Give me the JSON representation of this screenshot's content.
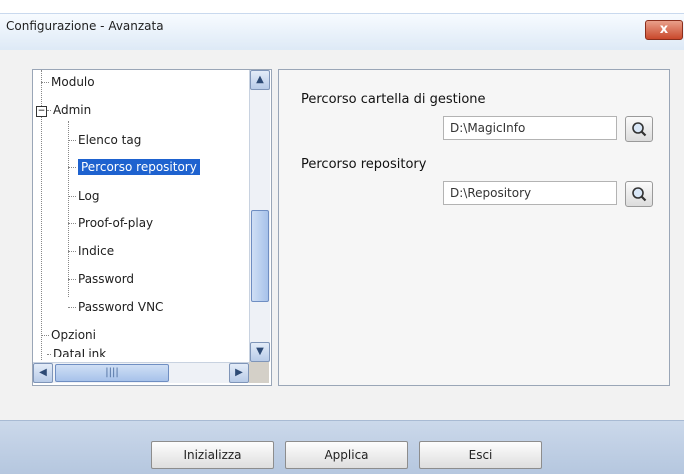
{
  "window": {
    "title": "Configurazione - Avanzata",
    "close_glyph": "x"
  },
  "tree": {
    "items": [
      {
        "label": "Modulo"
      },
      {
        "label": "Admin"
      },
      {
        "label": "Elenco tag"
      },
      {
        "label": "Percorso repository",
        "selected": true
      },
      {
        "label": "Log"
      },
      {
        "label": "Proof-of-play"
      },
      {
        "label": "Indice"
      },
      {
        "label": "Password"
      },
      {
        "label": "Password VNC"
      },
      {
        "label": "Opzioni"
      },
      {
        "label": "DataLink"
      }
    ]
  },
  "settings": {
    "management_folder_label": "Percorso cartella di gestione",
    "management_folder_value": "D:\\MagicInfo",
    "repository_label": "Percorso repository",
    "repository_value": "D:\\Repository"
  },
  "buttons": {
    "reset": "Inizializza",
    "apply": "Applica",
    "exit": "Esci"
  },
  "icons": {
    "browse": "magnifier-icon",
    "close": "close-icon"
  }
}
